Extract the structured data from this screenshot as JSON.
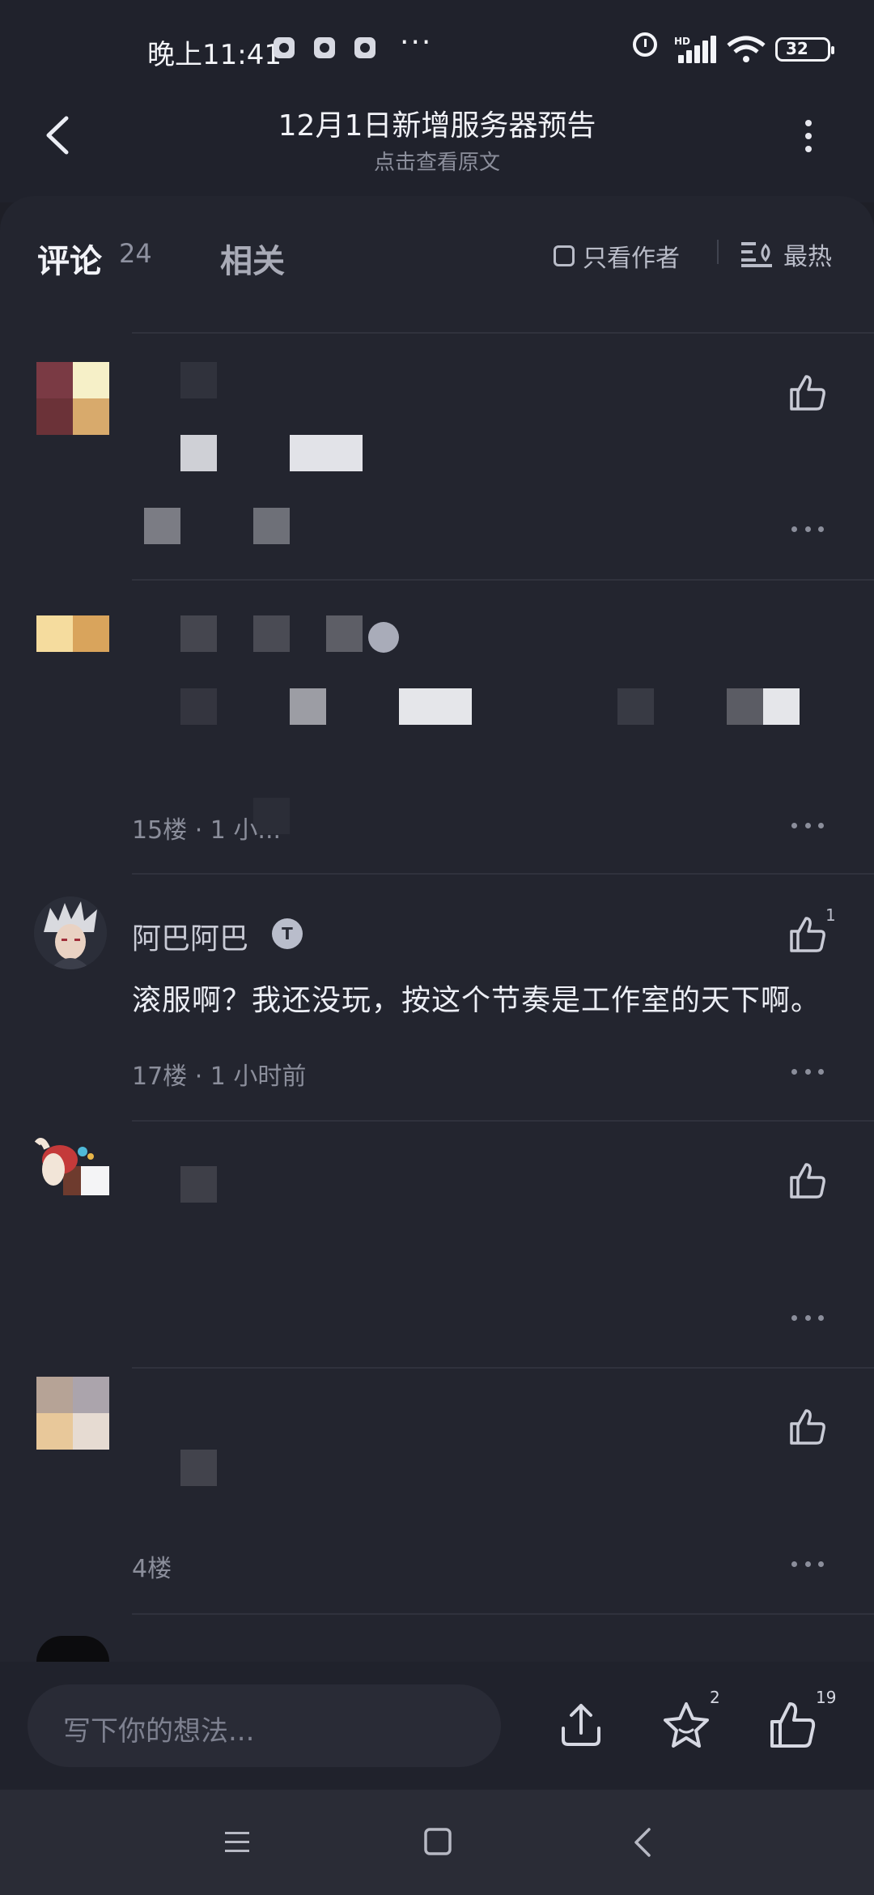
{
  "status_bar": {
    "time": "晚上11:41",
    "hd_label": "HD",
    "battery": "32"
  },
  "header": {
    "title": "12月1日新增服务器预告",
    "subtitle": "点击查看原文"
  },
  "tabs": {
    "comments_label": "评论",
    "comments_count": "24",
    "related_label": "相关",
    "author_only_label": "只看作者",
    "sort_label": "最热"
  },
  "comments": [
    {
      "floor": "15楼 · 1 小..."
    },
    {
      "username": "阿巴阿巴",
      "level": "T",
      "text": "滚服啊？我还没玩，按这个节奏是工作室的天下啊。",
      "floor_time": "17楼 · 1 小时前",
      "likes": "1"
    },
    {
      "floor": "4楼"
    }
  ],
  "composer": {
    "placeholder": "写下你的想法...",
    "favorites_count": "2",
    "likes_count": "19"
  },
  "colors": {
    "background": "#1e1f27",
    "sheet": "#23252f",
    "text": "#eceef5",
    "muted": "#8b8e9b"
  },
  "icons": [
    "back-icon",
    "more-vertical-icon",
    "sort-icon",
    "thumb-up-icon",
    "more-horizontal-icon",
    "share-icon",
    "star-icon",
    "menu-icon",
    "home-square-icon",
    "nav-back-icon"
  ]
}
